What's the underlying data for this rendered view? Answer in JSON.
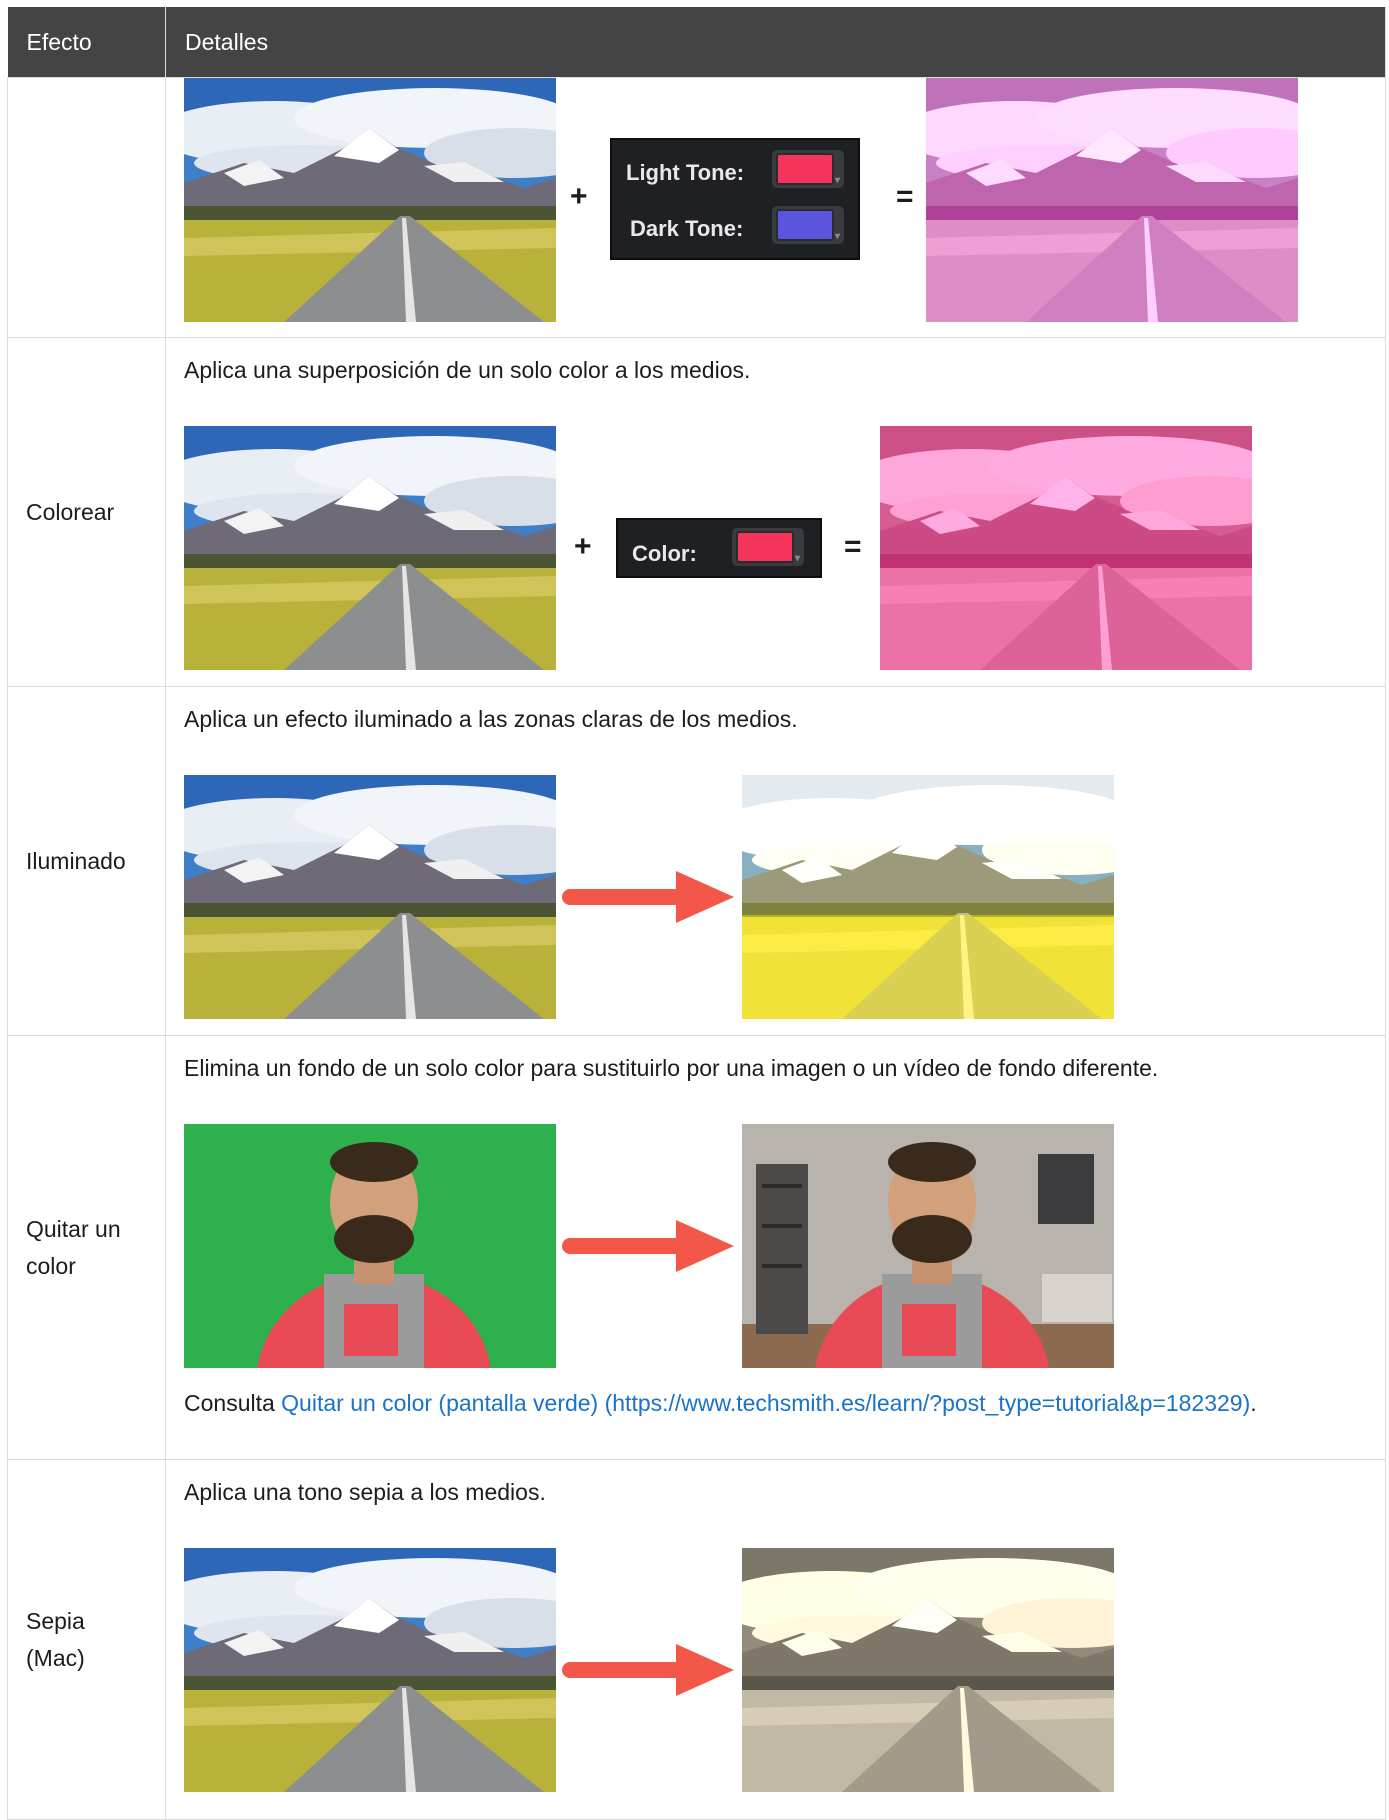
{
  "table": {
    "headers": {
      "effect": "Efecto",
      "details": "Detalles"
    },
    "rows": [
      {
        "effect": "",
        "duotone": {
          "light_label": "Light Tone:",
          "dark_label": "Dark Tone:",
          "light_color": "#f4345b",
          "dark_color": "#5b55de"
        },
        "operators": {
          "plus": "+",
          "equals": "="
        }
      },
      {
        "effect": "Colorear",
        "description": "Aplica una superposición de un solo color a los medios.",
        "panel": {
          "label": "Color:",
          "color": "#f4345b"
        },
        "operators": {
          "plus": "+",
          "equals": "="
        }
      },
      {
        "effect": "Iluminado",
        "description": "Aplica un efecto iluminado a las zonas claras de los medios."
      },
      {
        "effect": "Quitar un color",
        "description": "Elimina un fondo de un solo color para sustituirlo por una imagen o un vídeo de fondo diferente.",
        "note_prefix": "Consulta ",
        "link_text": "Quitar un color (pantalla verde) (https://www.techsmith.es/learn/?post_type=tutorial&p=182329)",
        "note_suffix": "."
      },
      {
        "effect": "Sepia (Mac)",
        "description": "Aplica una tono sepia a los medios."
      }
    ]
  },
  "colors": {
    "header_bg": "#444444",
    "arrow": "#f2574a",
    "link": "#1a73c8"
  },
  "icons": {
    "arrow": "right-arrow-icon"
  }
}
